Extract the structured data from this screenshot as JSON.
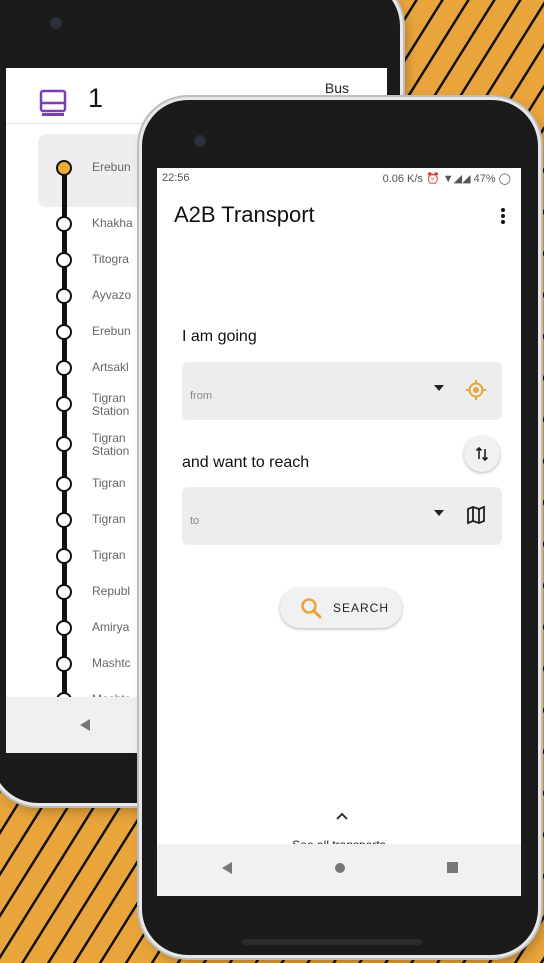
{
  "colors": {
    "accent": "#f2a93b",
    "bus": "#7b3fb0",
    "background_pattern": "#e9a53c",
    "phone_body": "#1b1b1b"
  },
  "back_screen": {
    "route_number": "1",
    "route_type": "Bus",
    "bus_icon": "bus-icon",
    "stops": [
      {
        "name": "Erebun",
        "active": true
      },
      {
        "name": "Khakha"
      },
      {
        "name": "Titogra"
      },
      {
        "name": "Ayvazo"
      },
      {
        "name": "Erebun"
      },
      {
        "name": "Artsakl"
      },
      {
        "name": "Tigran",
        "line2": "Station"
      },
      {
        "name": "Tigran",
        "line2": "Station"
      },
      {
        "name": "Tigran"
      },
      {
        "name": "Tigran"
      },
      {
        "name": "Tigran"
      },
      {
        "name": "Republ"
      },
      {
        "name": "Amirya"
      },
      {
        "name": "Mashtc"
      },
      {
        "name": "Mashtc"
      }
    ],
    "nav": {
      "back_icon": "back-triangle-icon"
    }
  },
  "front_screen": {
    "status_bar": {
      "time": "22:56",
      "right": "0.06 K/s ⏰ ▼◢◢ 47% ◯"
    },
    "title": "A2B Transport",
    "menu_icon": "more-vert-icon",
    "from_section": {
      "label": "I am going",
      "placeholder": "from",
      "action_icon": "my-location-icon"
    },
    "to_section": {
      "label": "and want to reach",
      "placeholder": "to",
      "action_icon": "map-icon"
    },
    "swap_icon": "swap-vert-icon",
    "search_button": {
      "label": "SEARCH",
      "icon": "search-icon"
    },
    "see_all": {
      "label": "See all transports",
      "icon": "chevron-up-icon"
    },
    "nav": {
      "back": "back-triangle-icon",
      "home": "home-circle-icon",
      "recents": "recents-square-icon"
    }
  }
}
